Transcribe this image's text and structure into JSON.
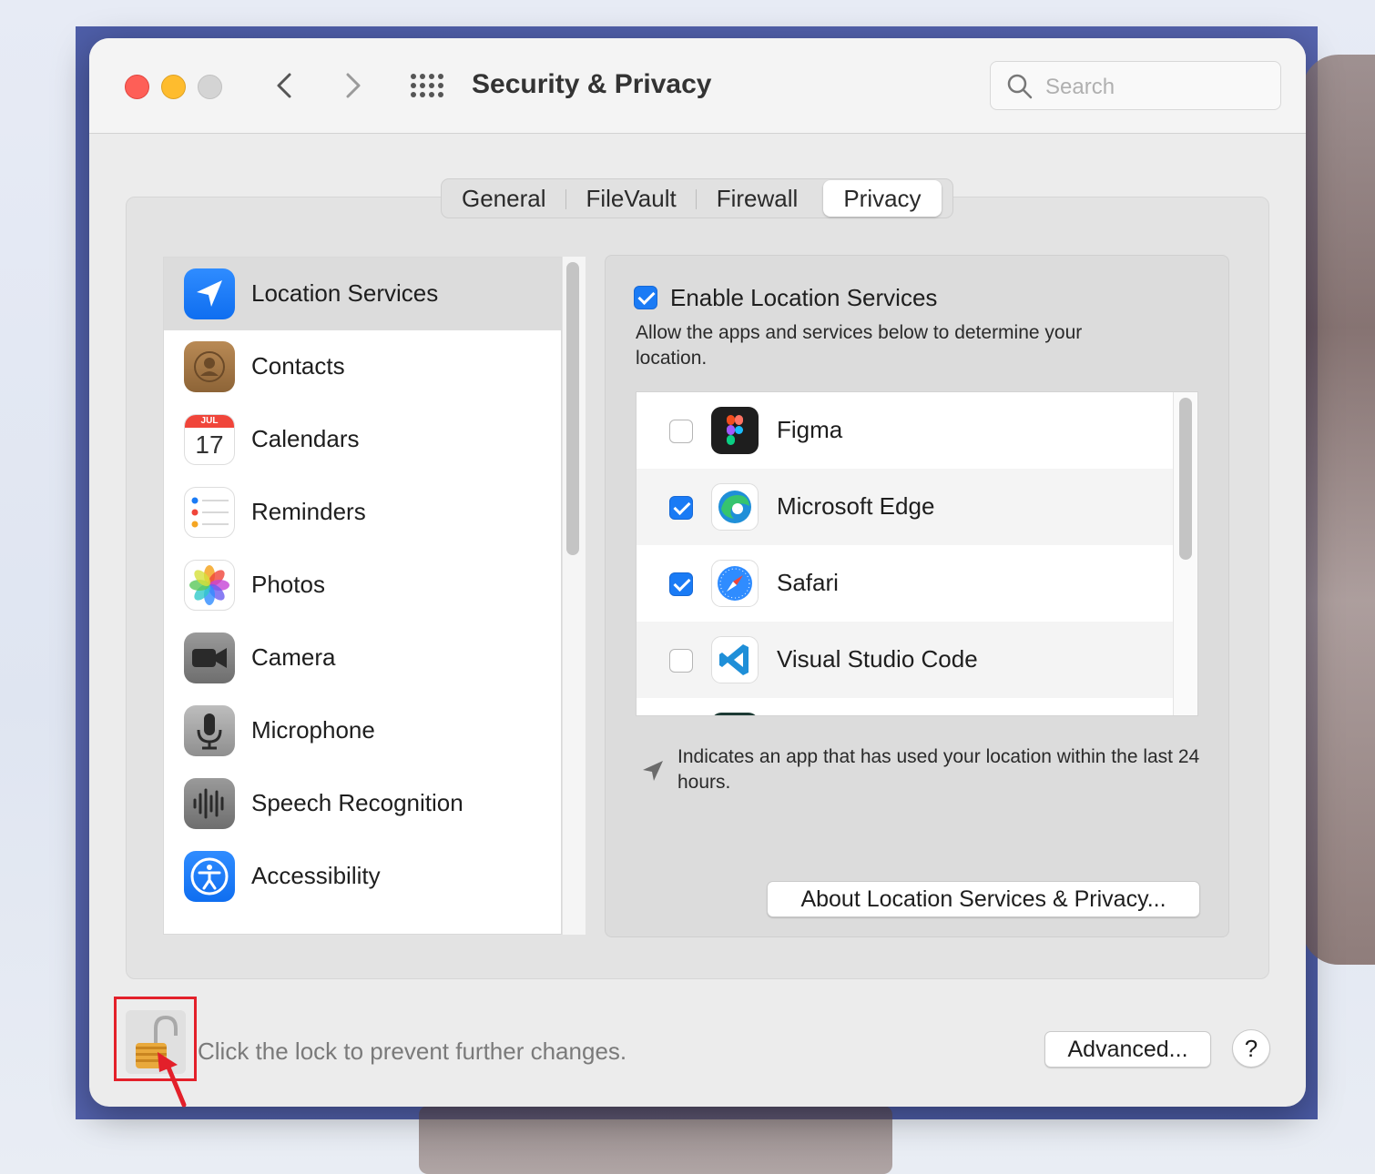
{
  "window": {
    "title": "Security & Privacy",
    "search_placeholder": "Search"
  },
  "tabs": [
    {
      "label": "General",
      "active": false
    },
    {
      "label": "FileVault",
      "active": false
    },
    {
      "label": "Firewall",
      "active": false
    },
    {
      "label": "Privacy",
      "active": true
    }
  ],
  "sidebar": {
    "items": [
      {
        "label": "Location Services",
        "icon": "location-arrow-icon",
        "selected": true
      },
      {
        "label": "Contacts",
        "icon": "contacts-icon",
        "selected": false
      },
      {
        "label": "Calendars",
        "icon": "calendar-icon",
        "selected": false,
        "icon_month": "JUL",
        "icon_day": "17"
      },
      {
        "label": "Reminders",
        "icon": "reminders-icon",
        "selected": false
      },
      {
        "label": "Photos",
        "icon": "photos-icon",
        "selected": false
      },
      {
        "label": "Camera",
        "icon": "camera-icon",
        "selected": false
      },
      {
        "label": "Microphone",
        "icon": "microphone-icon",
        "selected": false
      },
      {
        "label": "Speech Recognition",
        "icon": "speech-recognition-icon",
        "selected": false
      },
      {
        "label": "Accessibility",
        "icon": "accessibility-icon",
        "selected": false
      }
    ]
  },
  "location": {
    "enable_label": "Enable Location Services",
    "enabled": true,
    "description": "Allow the apps and services below to determine your location.",
    "apps": [
      {
        "name": "Figma",
        "checked": false,
        "icon": "figma-icon"
      },
      {
        "name": "Microsoft Edge",
        "checked": true,
        "icon": "edge-icon"
      },
      {
        "name": "Safari",
        "checked": true,
        "icon": "safari-icon"
      },
      {
        "name": "Visual Studio Code",
        "checked": false,
        "icon": "vscode-icon"
      }
    ],
    "note": "Indicates an app that has used your location within the last 24 hours.",
    "about_button": "About Location Services & Privacy..."
  },
  "footer": {
    "lock_text": "Click the lock to prevent further changes.",
    "advanced_button": "Advanced...",
    "help_button": "?"
  },
  "colors": {
    "accent": "#1a7bf5",
    "annotation": "#e3202a"
  }
}
